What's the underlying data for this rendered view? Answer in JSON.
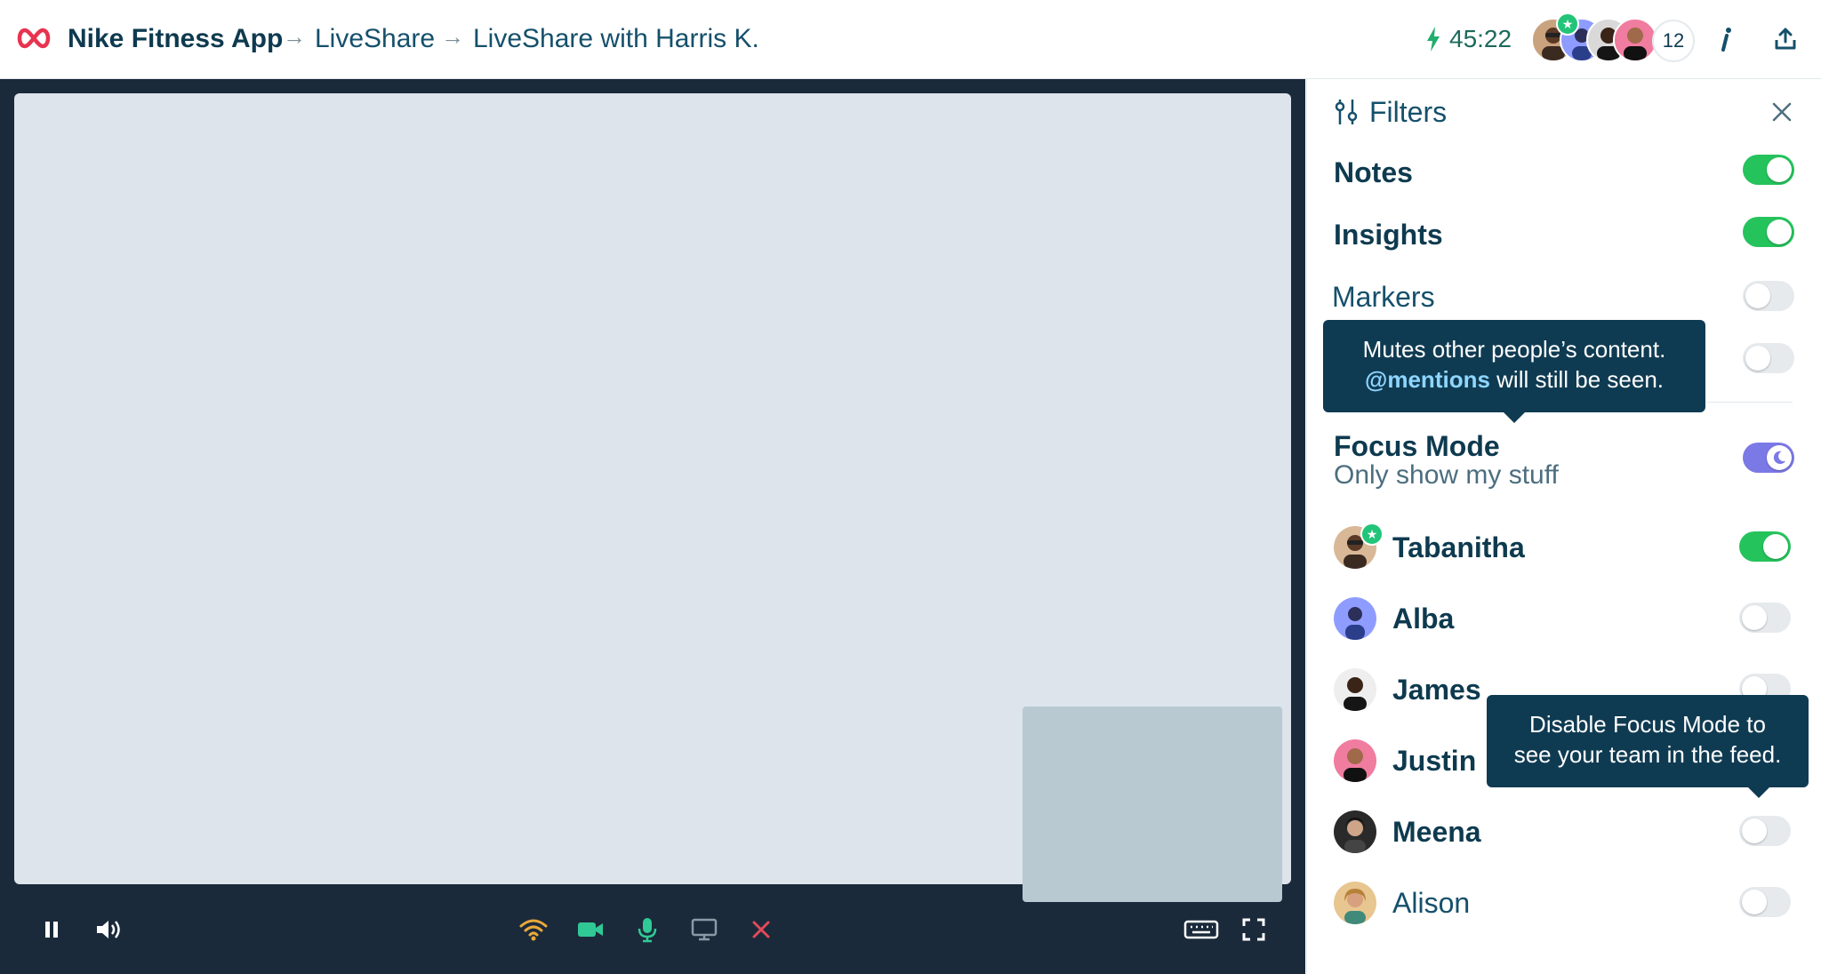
{
  "header": {
    "app_name": "Nike Fitness App",
    "crumb_separator": "→",
    "crumbs": [
      "LiveShare",
      "LiveShare with Harris K."
    ],
    "timer": "45:22",
    "participant_count": "12",
    "info_icon": "info-icon",
    "share_icon": "share-icon"
  },
  "panel": {
    "title": "Filters",
    "filters": [
      {
        "label": "Notes",
        "on": true
      },
      {
        "label": "Insights",
        "on": true
      },
      {
        "label": "Markers",
        "on": false
      }
    ],
    "tooltip_mute": {
      "line1": "Mutes other people’s content.",
      "mention": "@mentions",
      "line2_rest": " will still be seen."
    },
    "focus_mode": {
      "title": "Focus Mode",
      "subtitle": "Only show my stuff",
      "on": true
    },
    "people": [
      {
        "name": "Tabanitha",
        "on": true
      },
      {
        "name": "Alba",
        "on": false
      },
      {
        "name": "James",
        "on": false
      },
      {
        "name": "Justin",
        "on": false
      },
      {
        "name": "Meena",
        "on": false
      },
      {
        "name": "Alison",
        "on": false
      }
    ],
    "tooltip_focus": {
      "line1": "Disable Focus Mode to",
      "line2": "see your team in the feed."
    }
  },
  "colors": {
    "brand": "#e8334f",
    "toggle_on": "#25c35c",
    "focus_toggle": "#7b79e6",
    "tooltip_bg": "#0f3b52",
    "video_bg": "#1b2a3a",
    "end_call": "#e24a5a",
    "media_active": "#30c995"
  }
}
